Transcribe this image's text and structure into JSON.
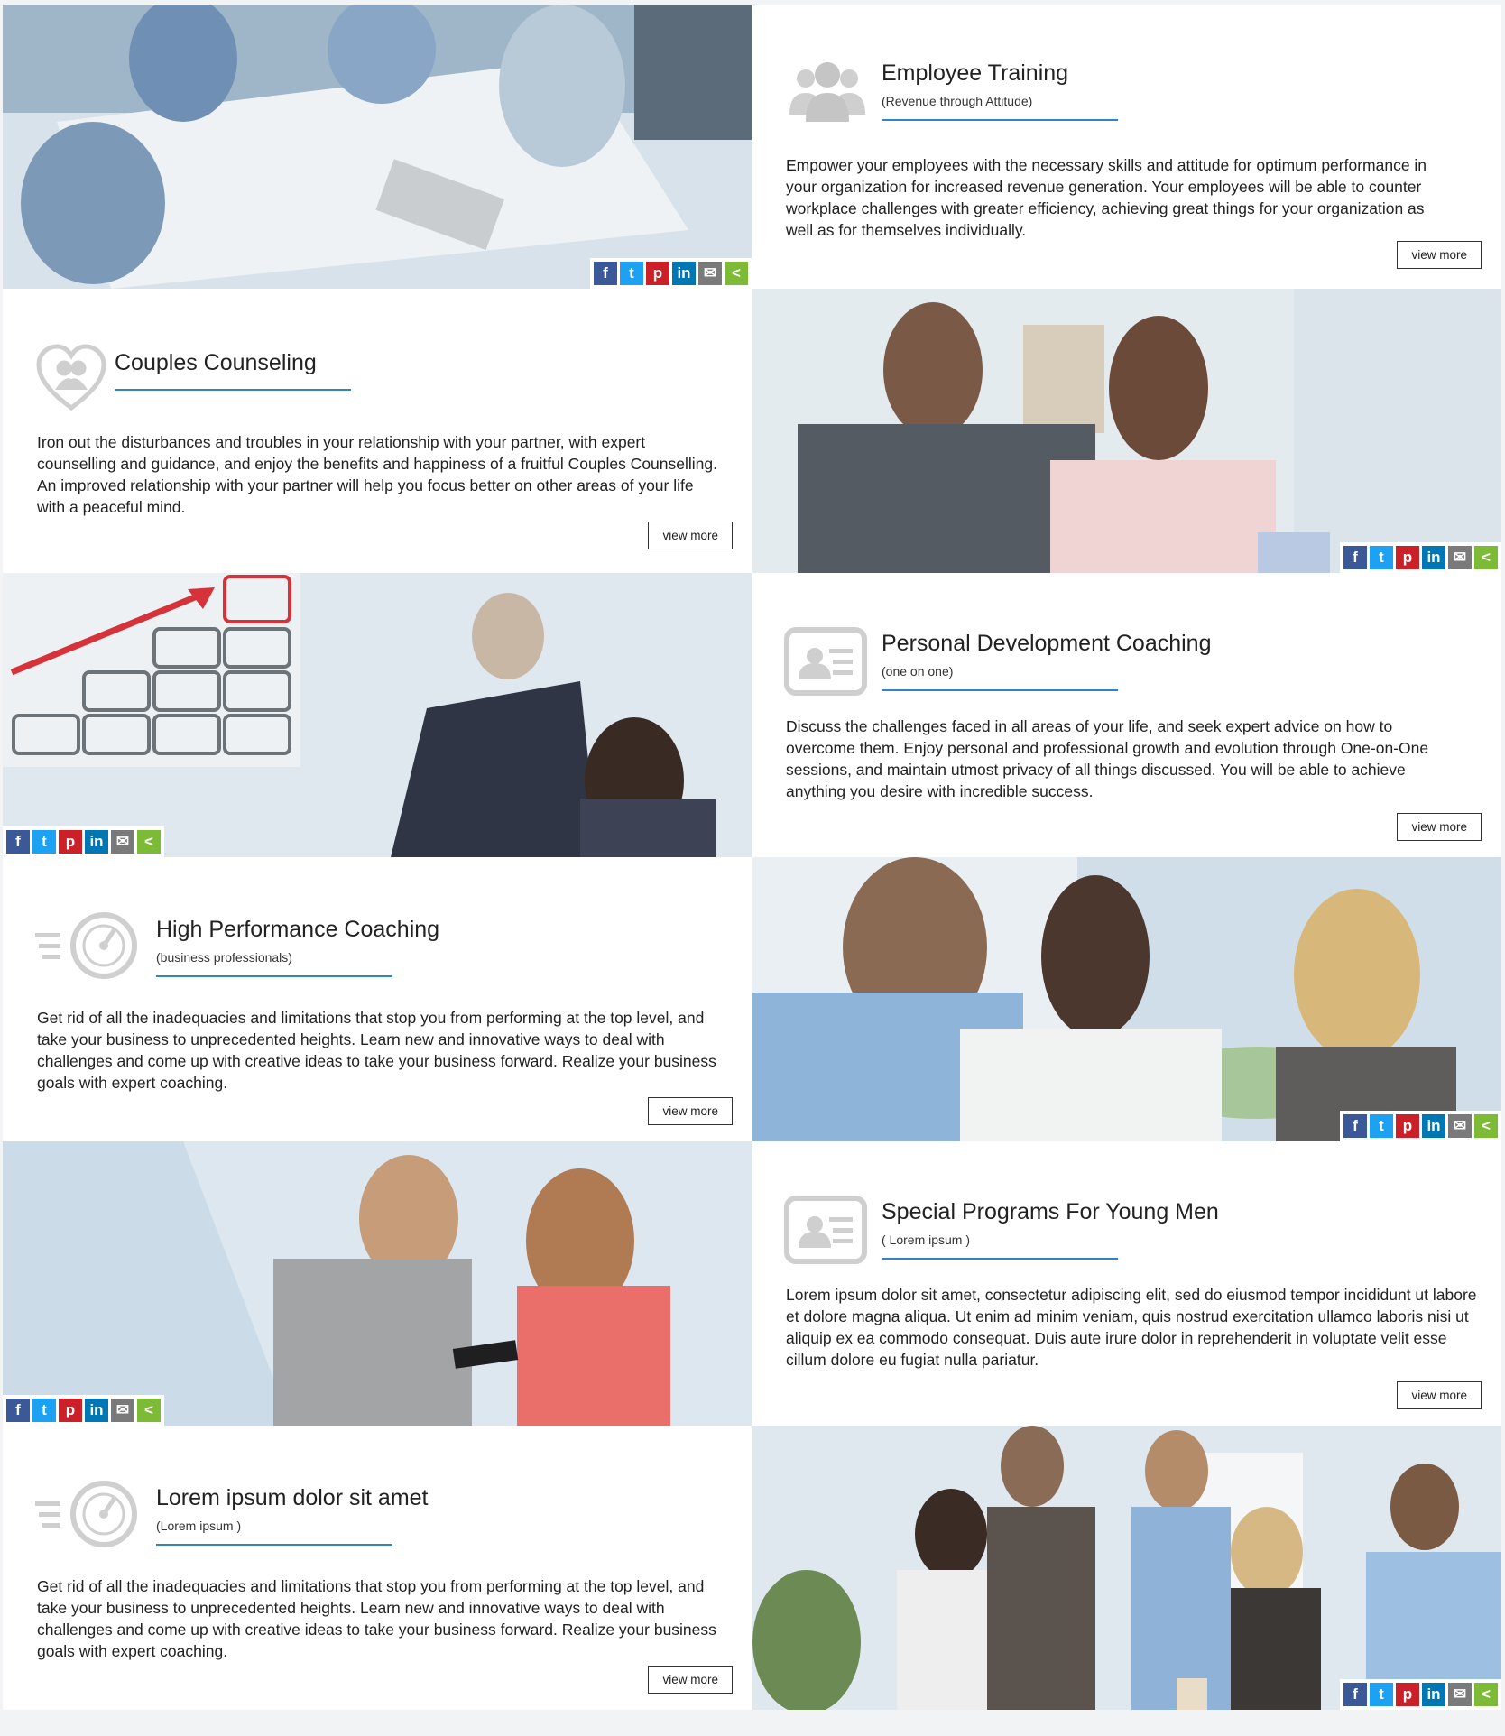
{
  "services": [
    {
      "title": "Employee Training",
      "subtitle": "(Revenue through Attitude)",
      "icon": "group-people-icon",
      "description": "Empower your employees with the necessary skills and attitude for optimum performance in your organization for increased revenue generation. Your employees will be able to counter workplace challenges with greater efficiency, achieving great things for your organization as well as for themselves individually.",
      "button": "view more"
    },
    {
      "title": "Couples Counseling",
      "subtitle": "",
      "icon": "heart-couple-icon",
      "description": "Iron out the disturbances and troubles in your relationship with your partner, with expert counselling and guidance, and enjoy the benefits and happiness of a fruitful Couples Counselling. An improved relationship with your partner will help you focus better on other areas of your life with a peaceful mind.",
      "button": "view more"
    },
    {
      "title": "Personal Development Coaching",
      "subtitle": "(one on one)",
      "icon": "id-card-icon",
      "description": "Discuss the challenges faced in all areas of your life, and seek expert advice on how to overcome them. Enjoy personal and professional growth and evolution through One-on-One sessions, and maintain utmost privacy of all things discussed. You will be able to achieve anything you desire with incredible success.",
      "button": "view more"
    },
    {
      "title": "High Performance Coaching",
      "subtitle": "(business professionals)",
      "icon": "speedometer-icon",
      "description": "Get rid of all the inadequacies and limitations that stop you from performing at the top level, and take your business to unprecedented heights. Learn new and innovative ways to deal with challenges and come up with creative ideas to take your business forward. Realize your business goals with expert coaching.",
      "button": "view more"
    },
    {
      "title": "Special Programs For Young Men",
      "subtitle": "( Lorem ipsum )",
      "icon": "id-card-icon",
      "description": "Lorem ipsum dolor sit amet, consectetur adipiscing elit, sed do eiusmod tempor incididunt ut labore et dolore magna aliqua. Ut enim ad minim veniam, quis nostrud exercitation ullamco laboris nisi ut aliquip ex ea commodo consequat. Duis aute irure dolor in reprehenderit in voluptate velit esse cillum dolore eu fugiat nulla pariatur.",
      "button": "view more"
    },
    {
      "title": "Lorem ipsum dolor sit amet",
      "subtitle": "(Lorem ipsum )",
      "icon": "speedometer-icon",
      "description": "Get rid of all the inadequacies and limitations that stop you from performing at the top level, and take your business to unprecedented heights. Learn new and innovative ways to deal with challenges and come up with creative ideas to take your business forward. Realize your business goals with expert coaching.",
      "button": "view more"
    }
  ],
  "share": {
    "facebook": "f",
    "twitter": "t",
    "pinterest": "p",
    "linkedin": "in",
    "email": "✉",
    "share": "<"
  },
  "colors": {
    "accent_underline": "#2d86c9",
    "facebook": "#3b5998",
    "twitter": "#1da1f2",
    "pinterest": "#cb2027",
    "linkedin": "#0077b5",
    "email": "#7a7a7a",
    "share": "#7dba35"
  }
}
